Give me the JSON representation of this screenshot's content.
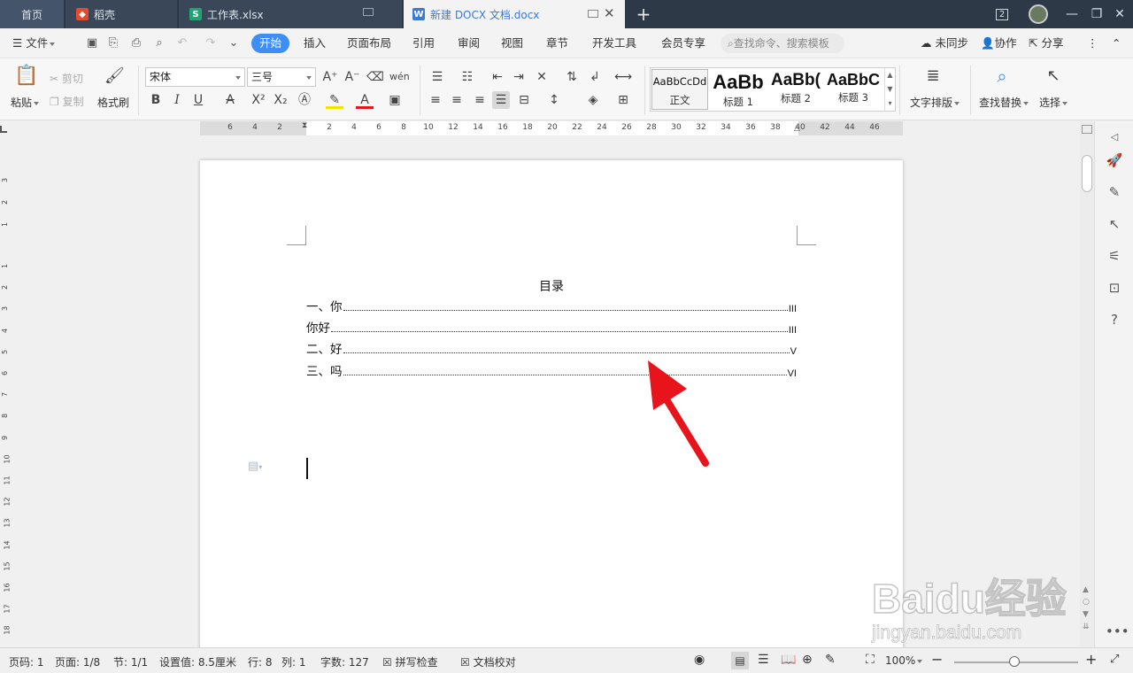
{
  "tabs": {
    "home": "首页",
    "daoke": "稻壳",
    "sheet": "工作表.xlsx",
    "doc": "新建 DOCX 文档.docx",
    "window_count": "2"
  },
  "menu": {
    "file": "文件",
    "items": [
      "开始",
      "插入",
      "页面布局",
      "引用",
      "审阅",
      "视图",
      "章节",
      "开发工具",
      "会员专享"
    ],
    "search_placeholder": "查找命令、搜索模板",
    "sync": "未同步",
    "collab": "协作",
    "share": "分享"
  },
  "ribbon": {
    "paste": "粘贴",
    "cut": "剪切",
    "copy": "复制",
    "format_painter": "格式刷",
    "font_name": "宋体",
    "font_size": "三号",
    "styles": [
      {
        "preview": "AaBbCcDd",
        "label": "正文"
      },
      {
        "preview": "AaBb",
        "label": "标题 1"
      },
      {
        "preview": "AaBb(",
        "label": "标题 2"
      },
      {
        "preview": "AaBbC",
        "label": "标题 3"
      }
    ],
    "text_layout": "文字排版",
    "find_replace": "查找替换",
    "select": "选择"
  },
  "ruler": {
    "h_labels": [
      "6",
      "4",
      "2",
      "2",
      "4",
      "6",
      "8",
      "10",
      "12",
      "14",
      "16",
      "18",
      "20",
      "22",
      "24",
      "26",
      "28",
      "30",
      "32",
      "34",
      "36",
      "38",
      "40",
      "42",
      "44",
      "46"
    ],
    "v_labels": [
      "3",
      "2",
      "1",
      "1",
      "2",
      "3",
      "4",
      "5",
      "6",
      "7",
      "8",
      "9",
      "10",
      "11",
      "12",
      "13",
      "14",
      "15",
      "16",
      "17",
      "18"
    ]
  },
  "document": {
    "toc_title": "目录",
    "toc": [
      {
        "text": "一、你",
        "page": "III"
      },
      {
        "text": "你好",
        "page": "III"
      },
      {
        "text": "二、好",
        "page": "V"
      },
      {
        "text": "三、吗",
        "page": "VI"
      }
    ]
  },
  "status": {
    "page_code": "页码: 1",
    "page": "页面: 1/8",
    "section": "节: 1/1",
    "setting": "设置值: 8.5厘米",
    "row": "行: 8",
    "col": "列: 1",
    "word_count": "字数: 127",
    "spell_check": "拼写检查",
    "doc_proof": "文档校对",
    "zoom": "100%"
  },
  "watermark": {
    "logo": "Baidu经验",
    "url": "jingyan.baidu.com"
  },
  "colors": {
    "accent": "#3f8ef7",
    "tabbar": "#2e3948",
    "arrow": "#e8141b"
  }
}
